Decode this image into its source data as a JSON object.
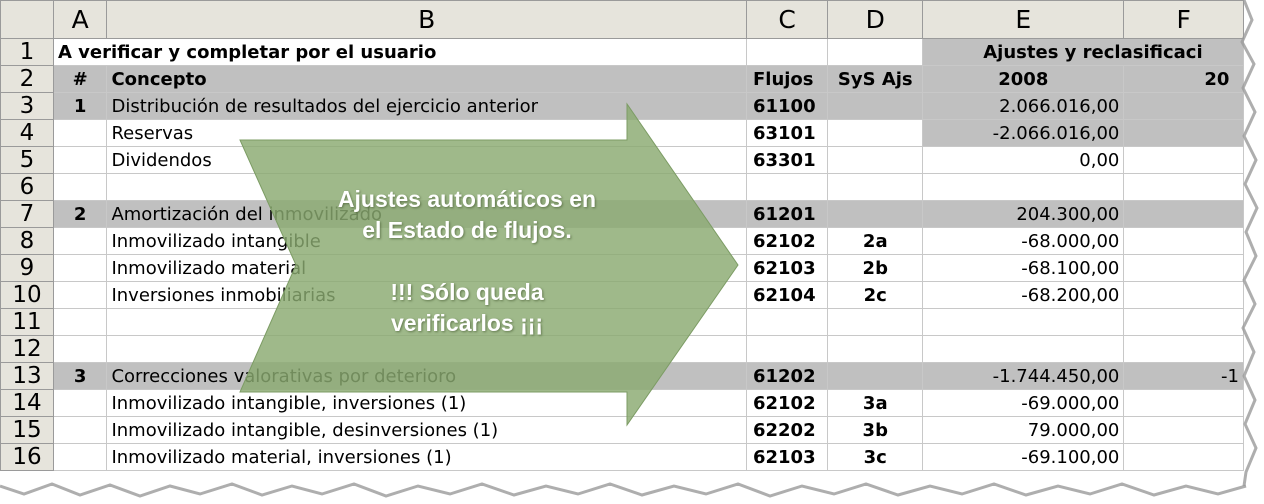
{
  "columns": [
    "A",
    "B",
    "C",
    "D",
    "E",
    "F"
  ],
  "rows": [
    {
      "n": "1",
      "a": "A verificar y completar por el usuario",
      "b": "",
      "c": "",
      "d": "",
      "e": "Ajustes y reclasificaci",
      "f": ""
    },
    {
      "n": "2",
      "a": "#",
      "b": "Concepto",
      "c": "Flujos",
      "d": "SyS Ajs",
      "e": "2008",
      "f": "20"
    },
    {
      "n": "3",
      "a": "1",
      "b": "Distribución de resultados del ejercicio anterior",
      "c": "61100",
      "d": "",
      "e": "2.066.016,00",
      "f": ""
    },
    {
      "n": "4",
      "a": "",
      "b": "Reservas",
      "c": "63101",
      "d": "",
      "e": "-2.066.016,00",
      "f": ""
    },
    {
      "n": "5",
      "a": "",
      "b": "Dividendos",
      "c": "63301",
      "d": "",
      "e": "0,00",
      "f": ""
    },
    {
      "n": "6",
      "a": "",
      "b": "",
      "c": "",
      "d": "",
      "e": "",
      "f": ""
    },
    {
      "n": "7",
      "a": "2",
      "b": "Amortización del inmovilizado",
      "c": "61201",
      "d": "",
      "e": "204.300,00",
      "f": ""
    },
    {
      "n": "8",
      "a": "",
      "b": "Inmovilizado intangible",
      "c": "62102",
      "d": "2a",
      "e": "-68.000,00",
      "f": ""
    },
    {
      "n": "9",
      "a": "",
      "b": "Inmovilizado material",
      "c": "62103",
      "d": "2b",
      "e": "-68.100,00",
      "f": ""
    },
    {
      "n": "10",
      "a": "",
      "b": "Inversiones inmobiliarias",
      "c": "62104",
      "d": "2c",
      "e": "-68.200,00",
      "f": ""
    },
    {
      "n": "11",
      "a": "",
      "b": "",
      "c": "",
      "d": "",
      "e": "",
      "f": ""
    },
    {
      "n": "12",
      "a": "",
      "b": "",
      "c": "",
      "d": "",
      "e": "",
      "f": ""
    },
    {
      "n": "13",
      "a": "3",
      "b": "Correcciones valorativas por deterioro",
      "c": "61202",
      "d": "",
      "e": "-1.744.450,00",
      "f": "-1"
    },
    {
      "n": "14",
      "a": "",
      "b": "Inmovilizado intangible, inversiones (1)",
      "c": "62102",
      "d": "3a",
      "e": "-69.000,00",
      "f": ""
    },
    {
      "n": "15",
      "a": "",
      "b": "Inmovilizado intangible, desinversiones (1)",
      "c": "62202",
      "d": "3b",
      "e": "79.000,00",
      "f": ""
    },
    {
      "n": "16",
      "a": "",
      "b": "Inmovilizado material, inversiones (1)",
      "c": "62103",
      "d": "3c",
      "e": "-69.100,00",
      "f": ""
    }
  ],
  "callout": {
    "line1": "Ajustes automáticos en",
    "line2": "el Estado de flujos.",
    "line3": "!!! Sólo queda",
    "line4": "verificarlos ¡¡¡"
  },
  "colors": {
    "header_bg": "#e6e4dc",
    "section_grey": "#c0c0c0",
    "arrow_fill": "#8aaa70"
  }
}
